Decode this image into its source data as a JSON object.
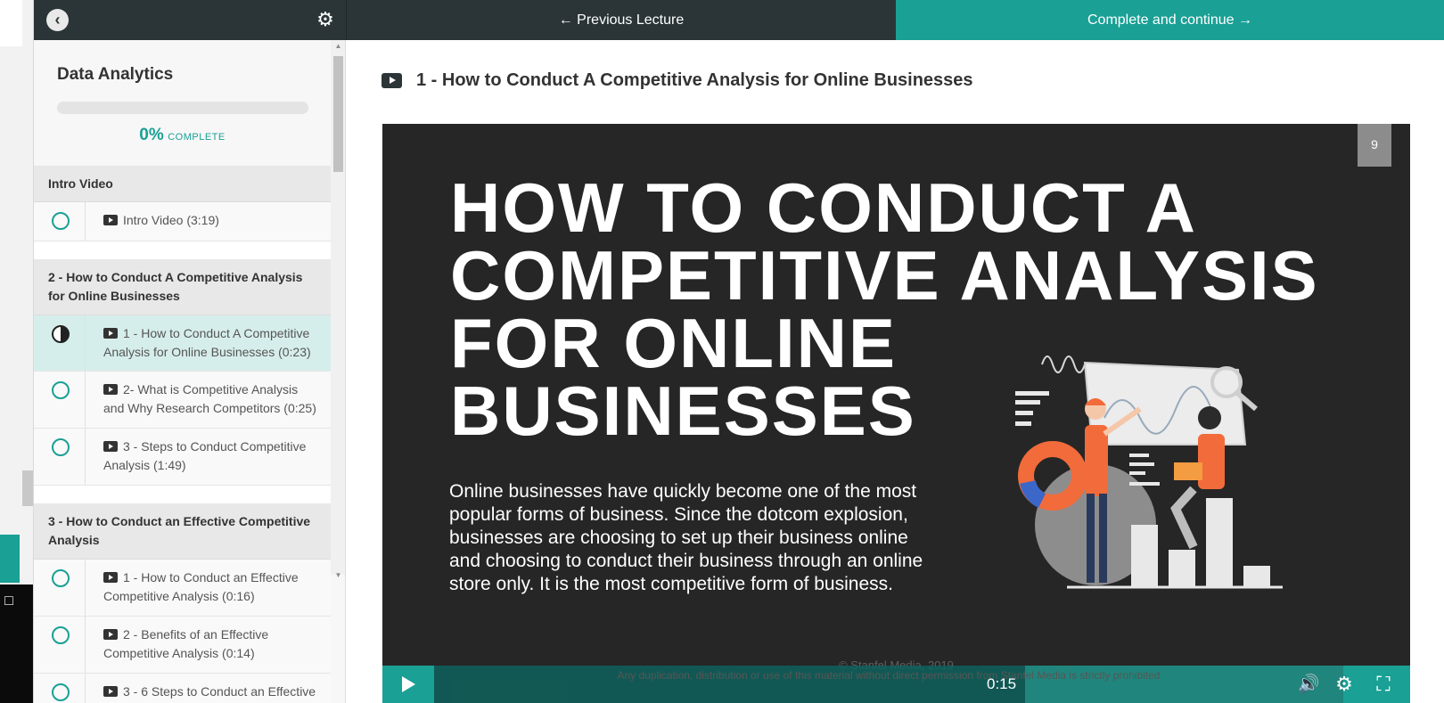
{
  "topbar": {
    "previous_label": "← Previous Lecture",
    "next_label": "Complete and continue →"
  },
  "sidebar": {
    "course_title": "Data Analytics",
    "progress_percent": 0,
    "progress_pct_text": "0%",
    "progress_label": "COMPLETE",
    "sections": [
      {
        "title": "Intro Video",
        "lectures": [
          {
            "title": "Intro Video (3:19)",
            "status": "not-started"
          }
        ]
      },
      {
        "title": "2 - How to Conduct A Competitive Analysis for Online Businesses",
        "lectures": [
          {
            "title": "1 - How to Conduct A Competitive Analysis for Online Businesses (0:23)",
            "status": "in-progress"
          },
          {
            "title": "2- What is Competitive Analysis and Why Research Competitors (0:25)",
            "status": "not-started"
          },
          {
            "title": "3 - Steps to Conduct Competitive Analysis (1:49)",
            "status": "not-started"
          }
        ]
      },
      {
        "title": "3 - How to Conduct an Effective Competitive Analysis",
        "lectures": [
          {
            "title": "1 - How to Conduct an Effective Competitive Analysis (0:16)",
            "status": "not-started"
          },
          {
            "title": "2 - Benefits of an Effective Competitive Analysis (0:14)",
            "status": "not-started"
          },
          {
            "title": "3 - 6 Steps to Conduct an Effective",
            "status": "not-started"
          }
        ]
      }
    ]
  },
  "main": {
    "lecture_title": "1 - How to Conduct A Competitive Analysis for Online Businesses",
    "video": {
      "slide_number": "9",
      "slide_title_lines": [
        "HOW TO CONDUCT A",
        "COMPETITIVE ANALYSIS",
        "FOR ONLINE",
        "BUSINESSES"
      ],
      "slide_body": "Online businesses have quickly become one of the most popular forms of business. Since the dotcom explosion, businesses are choosing to set up their business online and choosing to conduct their business through an online store only. It is the most competitive form of business.",
      "copyright": "© Stanfel Media, 2019",
      "disclaimer": "Any duplication, distribution or use of this material without direct permission from Stanfel Media is strictly prohibited",
      "current_time": "0:15",
      "played_fraction": 0.65
    }
  },
  "colors": {
    "accent": "#1aa095",
    "dark_bar": "#2b3537",
    "active_row": "#d6eeeb",
    "illustration_orange": "#f26b3a"
  }
}
